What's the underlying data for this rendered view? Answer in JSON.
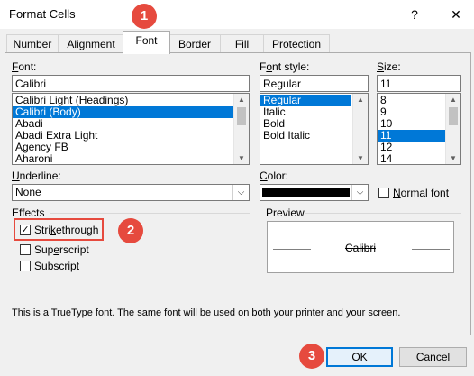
{
  "window": {
    "title": "Format Cells",
    "help_label": "?",
    "close_label": "✕"
  },
  "callouts": [
    "1",
    "2",
    "3"
  ],
  "tabs": [
    "Number",
    "Alignment",
    "Font",
    "Border",
    "Fill",
    "Protection"
  ],
  "active_tab": "Font",
  "font": {
    "label": "Font:",
    "value": "Calibri",
    "items": [
      "Calibri Light (Headings)",
      "Calibri (Body)",
      "Abadi",
      "Abadi Extra Light",
      "Agency FB",
      "Aharoni"
    ],
    "selected": "Calibri (Body)"
  },
  "font_style": {
    "label": "Font style:",
    "value": "Regular",
    "items": [
      "Regular",
      "Italic",
      "Bold",
      "Bold Italic"
    ],
    "selected": "Regular"
  },
  "size": {
    "label": "Size:",
    "value": "11",
    "items": [
      "8",
      "9",
      "10",
      "11",
      "12",
      "14"
    ],
    "selected": "11"
  },
  "underline": {
    "label": "Underline:",
    "value": "None"
  },
  "color": {
    "label": "Color:",
    "swatch": "#000000"
  },
  "normal_font": {
    "label": "Normal font",
    "checked": false
  },
  "effects": {
    "label": "Effects",
    "strikethrough": "Strikethrough",
    "superscript": "Superscript",
    "subscript": "Subscript",
    "strikethrough_checked": true
  },
  "preview": {
    "label": "Preview",
    "sample": "Calibri"
  },
  "info_text": "This is a TrueType font.  The same font will be used on both your printer and your screen.",
  "buttons": {
    "ok": "OK",
    "cancel": "Cancel"
  },
  "colors": {
    "callout": "#e64a3e",
    "selection": "#0078d7",
    "highlight_box": "#e64a3e"
  }
}
